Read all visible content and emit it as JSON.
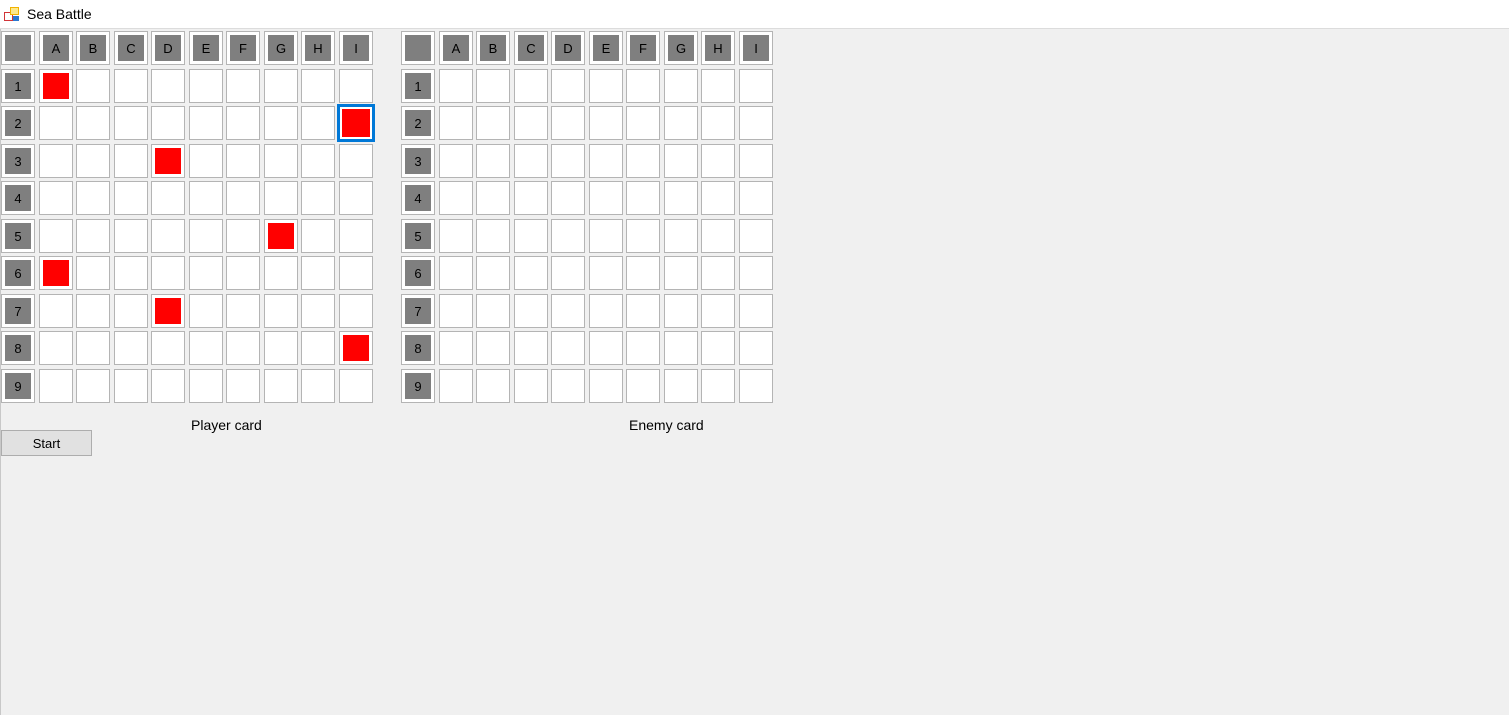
{
  "window": {
    "title": "Sea Battle",
    "icon": "app-icon"
  },
  "columns": [
    "A",
    "B",
    "C",
    "D",
    "E",
    "F",
    "G",
    "H",
    "I"
  ],
  "rows": [
    "1",
    "2",
    "3",
    "4",
    "5",
    "6",
    "7",
    "8",
    "9"
  ],
  "player_board": {
    "caption": "Player card",
    "ship_color": "#ff0000",
    "ships": [
      {
        "col": "A",
        "row": "1"
      },
      {
        "col": "I",
        "row": "2"
      },
      {
        "col": "D",
        "row": "3"
      },
      {
        "col": "G",
        "row": "5"
      },
      {
        "col": "A",
        "row": "6"
      },
      {
        "col": "D",
        "row": "7"
      },
      {
        "col": "I",
        "row": "8"
      }
    ],
    "focused_cell": {
      "col": "I",
      "row": "2"
    }
  },
  "enemy_board": {
    "caption": "Enemy card",
    "ships": []
  },
  "start_button": {
    "label": "Start"
  },
  "colors": {
    "header_fill": "#7f7f7f",
    "focus": "#0078d7",
    "background": "#f0f0f0"
  }
}
